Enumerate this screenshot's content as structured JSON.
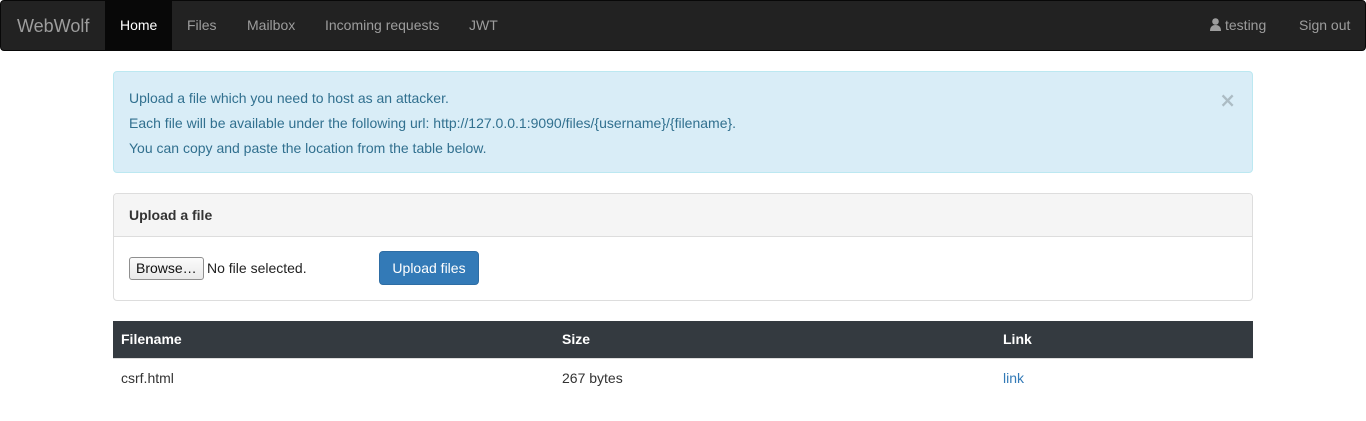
{
  "navbar": {
    "brand": "WebWolf",
    "items": [
      {
        "label": "Home",
        "active": true
      },
      {
        "label": "Files",
        "active": false
      },
      {
        "label": "Mailbox",
        "active": false
      },
      {
        "label": "Incoming requests",
        "active": false
      },
      {
        "label": "JWT",
        "active": false
      }
    ],
    "user": {
      "name": "testing",
      "icon": "user-icon"
    },
    "signout_label": "Sign out"
  },
  "alert": {
    "lines": [
      "Upload a file which you need to host as an attacker.",
      "Each file will be available under the following url: http://127.0.0.1:9090/files/{username}/{filename}.",
      "You can copy and paste the location from the table below."
    ],
    "close_glyph": "×"
  },
  "upload_panel": {
    "heading": "Upload a file",
    "browse_label": "Browse…",
    "file_status": "No file selected.",
    "upload_label": "Upload files"
  },
  "files_table": {
    "headers": [
      "Filename",
      "Size",
      "Link"
    ],
    "rows": [
      {
        "filename": "csrf.html",
        "size": "267 bytes",
        "link": "link"
      }
    ]
  },
  "colors": {
    "navbar_bg": "#222222",
    "alert_bg": "#d9edf7",
    "alert_text": "#31708f",
    "primary": "#337ab7",
    "table_header_bg": "#343a40"
  }
}
